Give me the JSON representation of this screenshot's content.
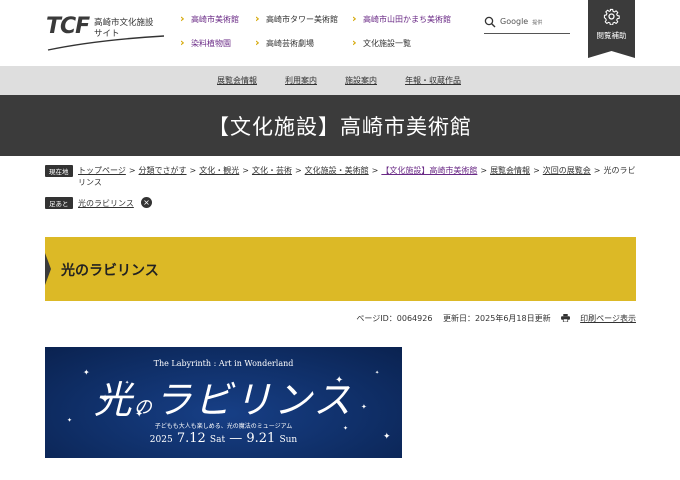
{
  "header": {
    "logo_mark": "TCF",
    "logo_line1": "高崎市文化施設",
    "logo_line2": "サイト",
    "nav": [
      {
        "label": "高崎市美術館"
      },
      {
        "label": "高崎市タワー美術館"
      },
      {
        "label": "高崎市山田かまち美術館"
      },
      {
        "label": "染料植物園"
      },
      {
        "label": "高崎芸術劇場"
      },
      {
        "label": "文化施設一覧"
      }
    ],
    "search_label": "Google",
    "search_sub": "提供",
    "access_label": "閲覧補助",
    "colors": {
      "accent": "#d4a600",
      "dark": "#3b3b3b",
      "link_visited": "#6a2a86"
    }
  },
  "subnav": [
    "展覧会情報",
    "利用案内",
    "施設案内",
    "年報・収蔵作品"
  ],
  "title": "【文化施設】高崎市美術館",
  "breadcrumb": {
    "tag": "現在地",
    "items": [
      "トップページ",
      "分類でさがす",
      "文化・観光",
      "文化・芸術",
      "文化施設・美術館",
      "【文化施設】高崎市美術館",
      "展覧会情報",
      "次回の展覧会"
    ],
    "current": "光のラビリンス",
    "separator": ">"
  },
  "footprint": {
    "tag": "足あと",
    "item": "光のラビリンス",
    "close": "×"
  },
  "page_heading": "光のラビリンス",
  "meta": {
    "page_id": "ページID：0064926",
    "updated": "更新日：2025年6月18日更新",
    "print": "印刷ページ表示"
  },
  "banner": {
    "subtitle": "The Labyrinth : Art in Wonderland",
    "title_a": "光",
    "title_no": "の",
    "title_b": "ラビリンス",
    "tagline": "子どもも大人も楽しめる、光の魔法のミュージアム",
    "year": "2025",
    "start": "7.12",
    "start_day": "Sat",
    "end": "9.21",
    "end_day": "Sun",
    "bg_color": "#0f2e66"
  }
}
